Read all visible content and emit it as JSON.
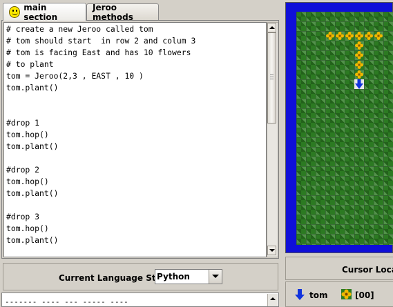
{
  "tabs": [
    {
      "label": "main section",
      "icon": "smiley-icon",
      "active": true
    },
    {
      "label": "Jeroo methods",
      "active": false
    }
  ],
  "editor": {
    "lines": [
      "# create a new Jeroo called tom",
      "# tom should start  in row 2 and colum 3",
      "# tom is facing East and has 10 flowers",
      "# to plant",
      "tom = Jeroo(2,3 , EAST , 10 )",
      "tom.plant()",
      "",
      "",
      "#drop 1",
      "tom.hop()",
      "tom.plant()",
      "",
      "#drop 2",
      "tom.hop()",
      "tom.plant()",
      "",
      "#drop 3",
      "tom.hop()",
      "tom.plant()"
    ]
  },
  "language": {
    "label": "Current Language Style",
    "selected": "Python"
  },
  "messages": {
    "text": "------- ---- --- ----- ----"
  },
  "island": {
    "colors": {
      "water": "#0f0fd8",
      "grass": "#2c7a22",
      "flower": "#f2b700"
    },
    "flowers_row_count": 6,
    "flowers_col_count": 5
  },
  "cursor": {
    "label": "Cursor Locat"
  },
  "status": {
    "jeroo_name": "tom",
    "flower_count": "[00]"
  }
}
